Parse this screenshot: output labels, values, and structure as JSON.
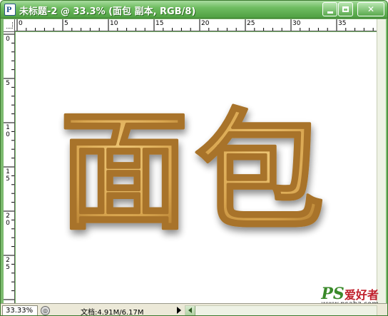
{
  "window": {
    "title": "未标题-2 @ 33.3% (面包 副本, RGB/8)",
    "accent_color": "#4fa043",
    "icons": {
      "app": "photoshop-doc-icon",
      "minimize": "minimize-icon",
      "maximize": "maximize-icon",
      "close": "close-icon"
    },
    "close_glyph": "✕"
  },
  "rulers": {
    "top_ticks": [
      "0",
      "5",
      "10",
      "15",
      "20",
      "25",
      "30",
      "35"
    ],
    "left_ticks": [
      [
        "0"
      ],
      [
        "5"
      ],
      [
        "1",
        "0"
      ],
      [
        "1",
        "5"
      ],
      [
        "2",
        "0"
      ],
      [
        "2",
        "5"
      ]
    ]
  },
  "artwork": {
    "text": "面包",
    "fill_color": "#d4a04c",
    "edge_color": "#b37a2a"
  },
  "status": {
    "zoom": "33.33%",
    "doc_info": "文档:4.91M/6.17M"
  },
  "watermark": {
    "brand_latin": "PS",
    "brand_cn": "爱好者",
    "url": "www.psahz.com"
  }
}
